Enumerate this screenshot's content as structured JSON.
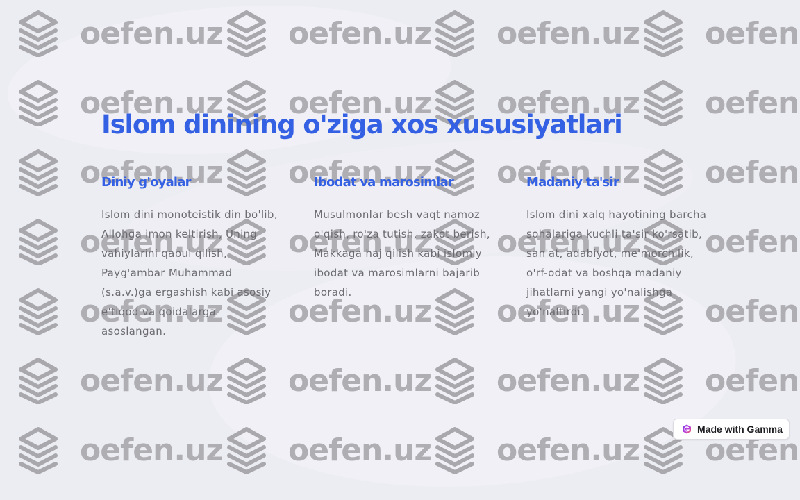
{
  "watermark": {
    "text": "oefen.uz",
    "icon": "stacked-layers-icon"
  },
  "slide": {
    "title": "Islom dinining o'ziga xos xususiyatlari",
    "columns": [
      {
        "heading": "Diniy g'oyalar",
        "body": "Islom dini monoteistik din bo'lib, Allohga imon keltirish, Uning vahiylarini qabul qilish, Payg'ambar Muhammad (s.a.v.)ga ergashish kabi asosiy e'tiqod va qoidalarga asoslangan."
      },
      {
        "heading": "Ibodat va marosimlar",
        "body": "Musulmonlar besh vaqt namoz o'qish, ro'za tutish, zakot berish, Makkaga haj qilish kabi islomiy ibodat va marosimlarni bajarib boradi."
      },
      {
        "heading": "Madaniy ta'sir",
        "body": "Islom dini xalq hayotining barcha sohalariga kuchli ta'sir ko'rsatib, san'at, adabiyot, me'morchilik, o'rf-odat va boshqa madaniy jihatlarni yangi yo'nalishga yo'naltirdi."
      }
    ]
  },
  "badge": {
    "label": "Made with Gamma",
    "icon": "gamma-logo-icon"
  },
  "colors": {
    "accent": "#3460e3",
    "body_text": "#6b6b70",
    "background": "#ecedf3",
    "watermark": "#afafb3"
  }
}
